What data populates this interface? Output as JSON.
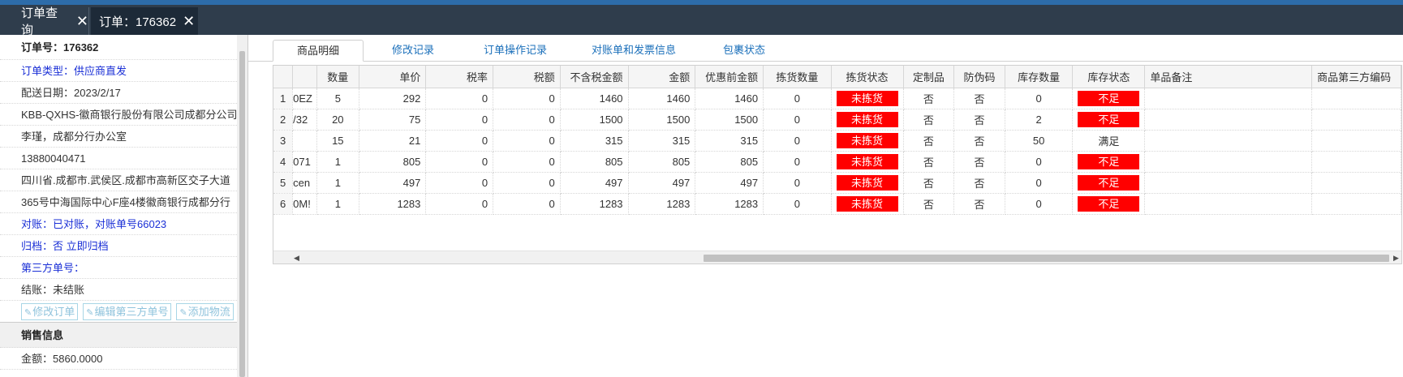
{
  "tabs": [
    {
      "label": "订单查询"
    },
    {
      "label": "订单：176362"
    }
  ],
  "left": {
    "order_no": "订单号：176362",
    "order_type": "订单类型：供应商直发",
    "delivery_date": "配送日期：2023/2/17",
    "company": "KBB-QXHS-徽商银行股份有限公司成都分公司",
    "contact": "李瑾，成都分行办公室",
    "phone": "13880040471",
    "address1": "四川省.成都市.武侯区.成都市高新区交子大道",
    "address2": "365号中海国际中心F座4楼徽商银行成都分行",
    "reconcile": "对账：已对账，对账单号66023",
    "archive": "归档：否 立即归档",
    "third_party": "第三方单号：",
    "settle": "结账：未结账",
    "buttons": {
      "edit_order": "修改订单",
      "edit_third": "编辑第三方单号",
      "add_logistics": "添加物流"
    },
    "sales_title": "销售信息",
    "amount": "金额：5860.0000"
  },
  "subtabs": [
    {
      "label": "商品明细"
    },
    {
      "label": "修改记录"
    },
    {
      "label": "订单操作记录"
    },
    {
      "label": "对账单和发票信息"
    },
    {
      "label": "包裹状态"
    }
  ],
  "table": {
    "headers": [
      "",
      "",
      "数量",
      "单价",
      "税率",
      "税额",
      "不含税金额",
      "金额",
      "优惠前金额",
      "拣货数量",
      "拣货状态",
      "定制品",
      "防伪码",
      "库存数量",
      "库存状态",
      "单品备注",
      "商品第三方编码"
    ],
    "rows": [
      {
        "n": "1",
        "name": "0EZ",
        "qty": "5",
        "price": "292",
        "rate": "0",
        "tax": "0",
        "net": "1460",
        "amt": "1460",
        "pre": "1460",
        "pick": "0",
        "pickst": "未拣货",
        "custom": "否",
        "anti": "否",
        "stock": "0",
        "stockst": "不足",
        "stock_ok": false,
        "remark": "",
        "code": ""
      },
      {
        "n": "2",
        "name": "/32",
        "qty": "20",
        "price": "75",
        "rate": "0",
        "tax": "0",
        "net": "1500",
        "amt": "1500",
        "pre": "1500",
        "pick": "0",
        "pickst": "未拣货",
        "custom": "否",
        "anti": "否",
        "stock": "2",
        "stockst": "不足",
        "stock_ok": false,
        "remark": "",
        "code": ""
      },
      {
        "n": "3",
        "name": "",
        "qty": "15",
        "price": "21",
        "rate": "0",
        "tax": "0",
        "net": "315",
        "amt": "315",
        "pre": "315",
        "pick": "0",
        "pickst": "未拣货",
        "custom": "否",
        "anti": "否",
        "stock": "50",
        "stockst": "满足",
        "stock_ok": true,
        "remark": "",
        "code": ""
      },
      {
        "n": "4",
        "name": "071",
        "qty": "1",
        "price": "805",
        "rate": "0",
        "tax": "0",
        "net": "805",
        "amt": "805",
        "pre": "805",
        "pick": "0",
        "pickst": "未拣货",
        "custom": "否",
        "anti": "否",
        "stock": "0",
        "stockst": "不足",
        "stock_ok": false,
        "remark": "",
        "code": ""
      },
      {
        "n": "5",
        "name": "cen",
        "qty": "1",
        "price": "497",
        "rate": "0",
        "tax": "0",
        "net": "497",
        "amt": "497",
        "pre": "497",
        "pick": "0",
        "pickst": "未拣货",
        "custom": "否",
        "anti": "否",
        "stock": "0",
        "stockst": "不足",
        "stock_ok": false,
        "remark": "",
        "code": ""
      },
      {
        "n": "6",
        "name": "0M!",
        "qty": "1",
        "price": "1283",
        "rate": "0",
        "tax": "0",
        "net": "1283",
        "amt": "1283",
        "pre": "1283",
        "pick": "0",
        "pickst": "未拣货",
        "custom": "否",
        "anti": "否",
        "stock": "0",
        "stockst": "不足",
        "stock_ok": false,
        "remark": "",
        "code": ""
      }
    ]
  },
  "colors": {
    "topbar": "#2f3d4c",
    "accent_blue": "#1a2fd6",
    "status_red": "#ff0000",
    "link_blue": "#1a6fba"
  },
  "icons": {
    "tab_close": "close-icon",
    "button_edit": "edit-icon"
  }
}
